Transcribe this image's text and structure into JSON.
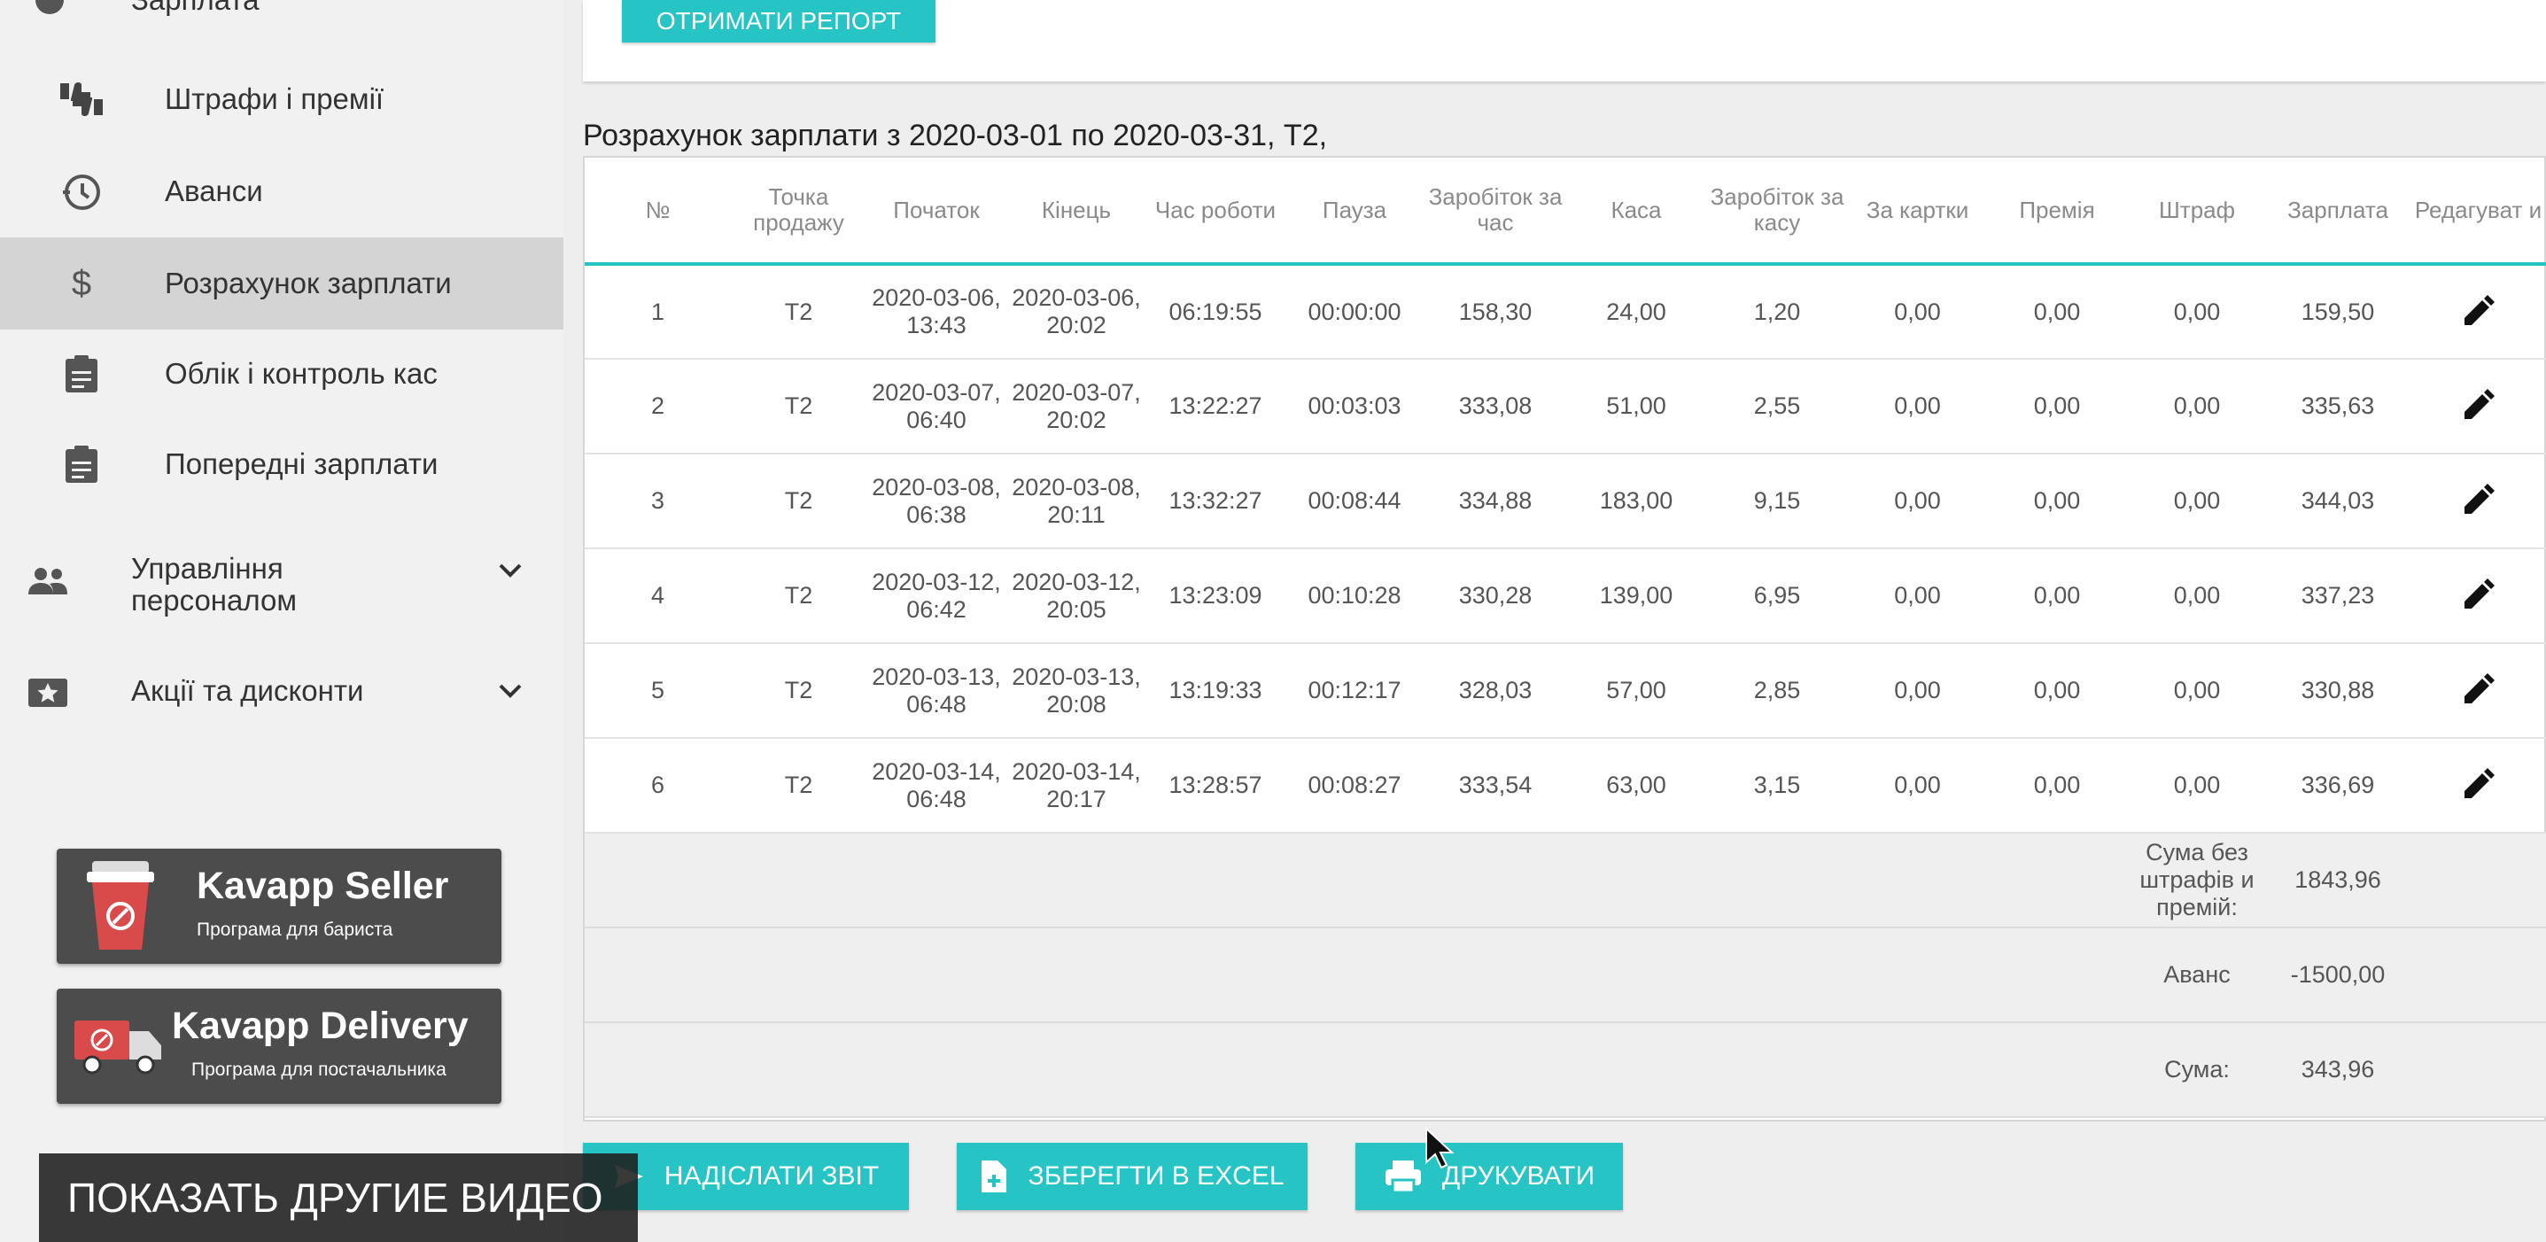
{
  "sidebar": {
    "top_label": "Зарплата",
    "items": [
      {
        "label": "Штрафи і премії",
        "icon": "thumbs-up-down-icon"
      },
      {
        "label": "Аванси",
        "icon": "clock-history-icon"
      },
      {
        "label": "Розрахунок зарплати",
        "icon": "dollar-icon",
        "active": true
      },
      {
        "label": "Облік і контроль кас",
        "icon": "clipboard-icon"
      },
      {
        "label": "Попередні зарплати",
        "icon": "clipboard-icon"
      }
    ],
    "groups": [
      {
        "label_line1": "Управління",
        "label_line2": "персоналом",
        "icon": "people-icon"
      },
      {
        "label": "Акції та дисконти",
        "icon": "star-card-icon"
      }
    ],
    "promos": [
      {
        "title": "Kavapp Seller",
        "subtitle": "Програма для бариста",
        "icon": "coffee-cup-icon"
      },
      {
        "title": "Kavapp Delivery",
        "subtitle": "Програма для постачальника",
        "icon": "delivery-truck-icon"
      }
    ]
  },
  "top_button": "ОТРИМАТИ РЕПОРТ",
  "heading": "Розрахунок зарплати з 2020-03-01 по 2020-03-31, Т2,",
  "table": {
    "columns": [
      "№",
      "Точка продажу",
      "Початок",
      "Кінець",
      "Час роботи",
      "Пауза",
      "Заробіток за час",
      "Каса",
      "Заробіток за касу",
      "За картки",
      "Премія",
      "Штраф",
      "Зарплата",
      "Редагуват и"
    ],
    "rows": [
      {
        "n": "1",
        "point": "Т2",
        "start_d": "2020-03-06,",
        "start_t": "13:43",
        "end_d": "2020-03-06,",
        "end_t": "20:02",
        "work": "06:19:55",
        "pause": "00:00:00",
        "earn_time": "158,30",
        "cash": "24,00",
        "earn_cash": "1,20",
        "cards": "0,00",
        "bonus": "0,00",
        "fine": "0,00",
        "salary": "159,50"
      },
      {
        "n": "2",
        "point": "Т2",
        "start_d": "2020-03-07,",
        "start_t": "06:40",
        "end_d": "2020-03-07,",
        "end_t": "20:02",
        "work": "13:22:27",
        "pause": "00:03:03",
        "earn_time": "333,08",
        "cash": "51,00",
        "earn_cash": "2,55",
        "cards": "0,00",
        "bonus": "0,00",
        "fine": "0,00",
        "salary": "335,63"
      },
      {
        "n": "3",
        "point": "Т2",
        "start_d": "2020-03-08,",
        "start_t": "06:38",
        "end_d": "2020-03-08,",
        "end_t": "20:11",
        "work": "13:32:27",
        "pause": "00:08:44",
        "earn_time": "334,88",
        "cash": "183,00",
        "earn_cash": "9,15",
        "cards": "0,00",
        "bonus": "0,00",
        "fine": "0,00",
        "salary": "344,03"
      },
      {
        "n": "4",
        "point": "Т2",
        "start_d": "2020-03-12,",
        "start_t": "06:42",
        "end_d": "2020-03-12,",
        "end_t": "20:05",
        "work": "13:23:09",
        "pause": "00:10:28",
        "earn_time": "330,28",
        "cash": "139,00",
        "earn_cash": "6,95",
        "cards": "0,00",
        "bonus": "0,00",
        "fine": "0,00",
        "salary": "337,23"
      },
      {
        "n": "5",
        "point": "Т2",
        "start_d": "2020-03-13,",
        "start_t": "06:48",
        "end_d": "2020-03-13,",
        "end_t": "20:08",
        "work": "13:19:33",
        "pause": "00:12:17",
        "earn_time": "328,03",
        "cash": "57,00",
        "earn_cash": "2,85",
        "cards": "0,00",
        "bonus": "0,00",
        "fine": "0,00",
        "salary": "330,88"
      },
      {
        "n": "6",
        "point": "Т2",
        "start_d": "2020-03-14,",
        "start_t": "06:48",
        "end_d": "2020-03-14,",
        "end_t": "20:17",
        "work": "13:28:57",
        "pause": "00:08:27",
        "earn_time": "333,54",
        "cash": "63,00",
        "earn_cash": "3,15",
        "cards": "0,00",
        "bonus": "0,00",
        "fine": "0,00",
        "salary": "336,69"
      }
    ],
    "summary": [
      {
        "label": "Сума без штрафів и премій:",
        "value": "1843,96"
      },
      {
        "label": "Аванс",
        "value": "-1500,00"
      },
      {
        "label": "Сума:",
        "value": "343,96"
      }
    ]
  },
  "bottom_buttons": [
    {
      "label": "НАДІСЛАТИ ЗВІТ",
      "icon": "send-icon"
    },
    {
      "label": "ЗБЕРЕГТИ В EXCEL",
      "icon": "file-add-icon"
    },
    {
      "label": "ДРУКУВАТИ",
      "icon": "printer-icon"
    }
  ],
  "overlay_text": "ПОКАЗАТЬ ДРУГИЕ ВИДЕО",
  "colors": {
    "accent": "#26c4c5",
    "active_bg": "#d4d4d4",
    "promo_bg": "#4c4c4c"
  }
}
